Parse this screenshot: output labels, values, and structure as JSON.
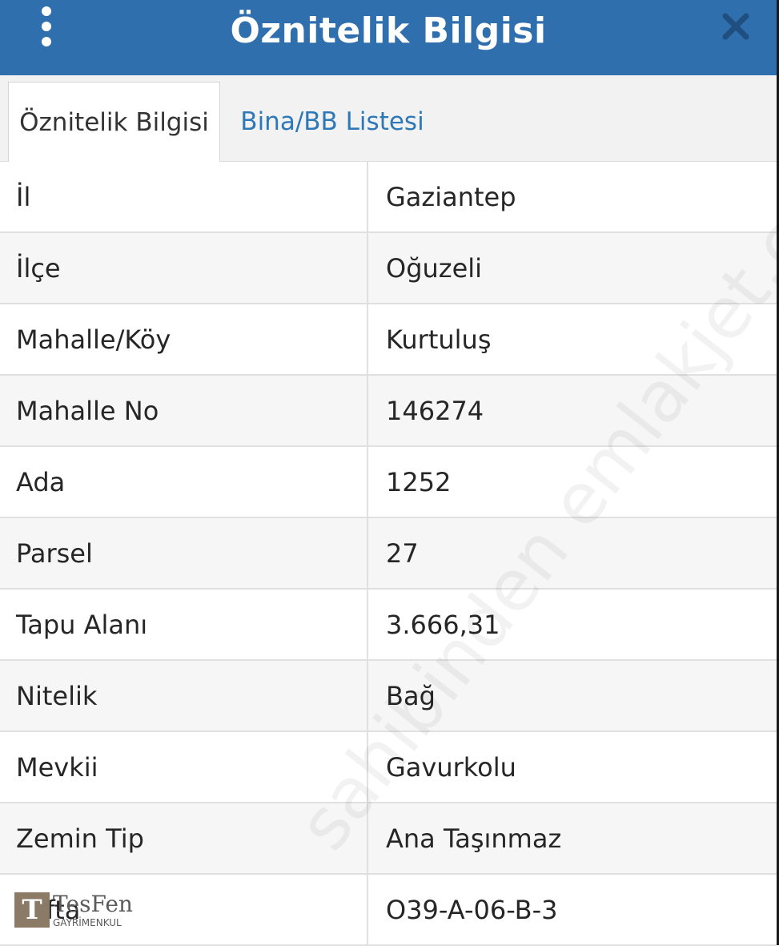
{
  "header": {
    "title": "Öznitelik Bilgisi",
    "menu_icon": "more-vertical-icon",
    "close_icon": "close-icon",
    "background_color": "#2f6fae"
  },
  "tabs": [
    {
      "label": "Öznitelik Bilgisi",
      "active": true
    },
    {
      "label": "Bina/BB Listesi",
      "active": false
    }
  ],
  "rows": [
    {
      "label": "İl",
      "value": "Gaziantep"
    },
    {
      "label": "İlçe",
      "value": "Oğuzeli"
    },
    {
      "label": "Mahalle/Köy",
      "value": "Kurtuluş"
    },
    {
      "label": "Mahalle No",
      "value": "146274"
    },
    {
      "label": "Ada",
      "value": "1252"
    },
    {
      "label": "Parsel",
      "value": "27"
    },
    {
      "label": "Tapu Alanı",
      "value": "3.666,31"
    },
    {
      "label": "Nitelik",
      "value": "Bağ"
    },
    {
      "label": "Mevkii",
      "value": "Gavurkolu"
    },
    {
      "label": "Zemin Tip",
      "value": "Ana Taşınmaz"
    },
    {
      "label": "Pafta",
      "value": "O39-A-06-B-3"
    }
  ],
  "watermark": "sahibinden emlakjet.com",
  "logo": {
    "mark": "T",
    "name": "TesFen",
    "sub": "GAYRİMENKUL"
  }
}
